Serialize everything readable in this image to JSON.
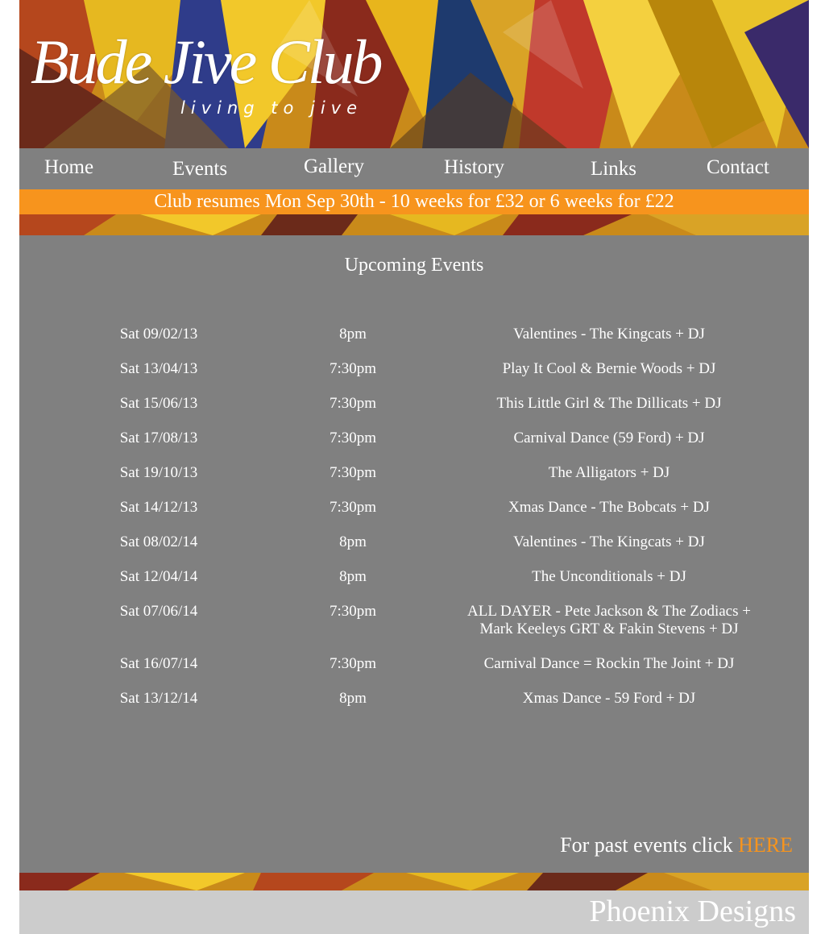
{
  "logo": {
    "name": "Bude Jive Club",
    "tagline": "living to jive"
  },
  "nav": {
    "items": [
      {
        "label": "Home"
      },
      {
        "label": "Events"
      },
      {
        "label": "Gallery"
      },
      {
        "label": "History"
      },
      {
        "label": "Links"
      },
      {
        "label": "Contact"
      }
    ]
  },
  "announcement": "Club resumes Mon Sep 30th - 10 weeks for £32 or 6 weeks for £22",
  "content": {
    "title": "Upcoming Events",
    "events": [
      {
        "date": "Sat 09/02/13",
        "time": "8pm",
        "title": "Valentines - The Kingcats + DJ"
      },
      {
        "date": "Sat 13/04/13",
        "time": "7:30pm",
        "title": "Play It Cool & Bernie Woods + DJ"
      },
      {
        "date": "Sat 15/06/13",
        "time": "7:30pm",
        "title": "This Little Girl & The Dillicats + DJ"
      },
      {
        "date": "Sat 17/08/13",
        "time": "7:30pm",
        "title": "Carnival Dance (59 Ford) + DJ"
      },
      {
        "date": "Sat 19/10/13",
        "time": "7:30pm",
        "title": "The Alligators + DJ"
      },
      {
        "date": "Sat 14/12/13",
        "time": "7:30pm",
        "title": "Xmas Dance - The Bobcats + DJ"
      },
      {
        "date": "Sat 08/02/14",
        "time": "8pm",
        "title": "Valentines - The Kingcats + DJ"
      },
      {
        "date": "Sat 12/04/14",
        "time": "8pm",
        "title": "The Unconditionals + DJ"
      },
      {
        "date": "Sat 07/06/14",
        "time": "7:30pm",
        "title": "ALL DAYER - Pete Jackson & The Zodiacs + Mark Keeleys GRT & Fakin Stevens + DJ"
      },
      {
        "date": "Sat 16/07/14",
        "time": "7:30pm",
        "title": "Carnival Dance = Rockin The Joint + DJ"
      },
      {
        "date": "Sat 13/12/14",
        "time": "8pm",
        "title": "Xmas Dance - 59 Ford + DJ"
      }
    ],
    "past_events_text": "For past events click ",
    "past_events_link": "HERE"
  },
  "footer": {
    "credit": "Phoenix Designs"
  },
  "colors": {
    "accent": "#f7941d",
    "panel": "#808080",
    "footer": "#cccccc"
  }
}
